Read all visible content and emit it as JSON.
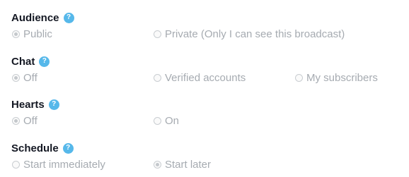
{
  "colors": {
    "heading": "#141823",
    "help_badge": "#56b8ea",
    "option_text": "#a6abb1",
    "radio_border": "#c9cdd1"
  },
  "sections": [
    {
      "title": "Audience",
      "help_icon": "question-mark-icon",
      "help_glyph": "?",
      "options": [
        {
          "label": "Public",
          "checked": true
        },
        {
          "label": "Private (Only I can see this broadcast)",
          "checked": false
        }
      ]
    },
    {
      "title": "Chat",
      "help_icon": "question-mark-icon",
      "help_glyph": "?",
      "options": [
        {
          "label": "Off",
          "checked": true
        },
        {
          "label": "Verified accounts",
          "checked": false
        },
        {
          "label": "My subscribers",
          "checked": false
        }
      ]
    },
    {
      "title": "Hearts",
      "help_icon": "question-mark-icon",
      "help_glyph": "?",
      "options": [
        {
          "label": "Off",
          "checked": true
        },
        {
          "label": "On",
          "checked": false
        }
      ]
    },
    {
      "title": "Schedule",
      "help_icon": "question-mark-icon",
      "help_glyph": "?",
      "options": [
        {
          "label": "Start immediately",
          "checked": false
        },
        {
          "label": "Start later",
          "checked": true
        }
      ]
    }
  ]
}
